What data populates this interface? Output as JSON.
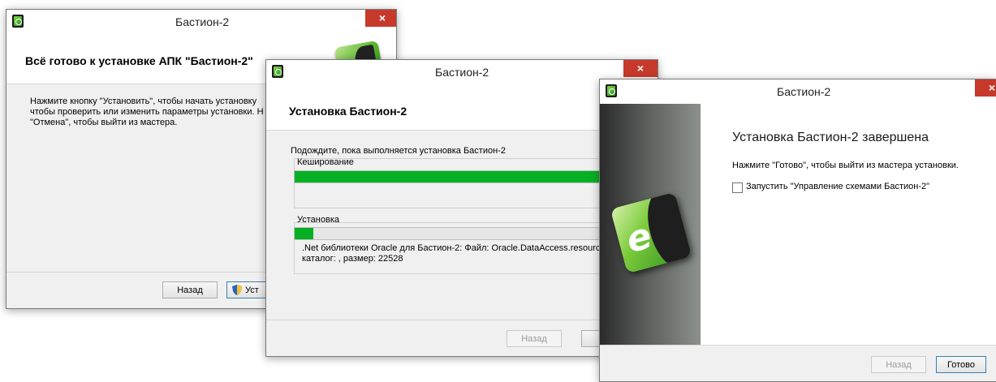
{
  "windows": [
    {
      "title": "Бастион-2",
      "close_glyph": "×",
      "header_title": "Всё готово к установке АПК \"Бастион-2\"",
      "body_lines": [
        "Нажмите кнопку \"Установить\", чтобы начать установку",
        "чтобы проверить или изменить параметры установки. Н",
        "\"Отмена\", чтобы выйти из мастера."
      ],
      "back_label": "Назад",
      "install_label": "Установить",
      "install_visible_text": "Уст"
    },
    {
      "title": "Бастион-2",
      "close_glyph": "×",
      "header_title": "Установка Бастион-2",
      "status_text": "Подождите, пока выполняется установка Бастион-2",
      "caching_label": "Кеширование",
      "caching_progress": 1.0,
      "install_label": "Установка",
      "install_progress": 0.05,
      "detail_line1": ".Net библиотеки Oracle для Бастион-2: Файл: Oracle.DataAccess.resource",
      "detail_line2": "каталог: ,  размер: 22528",
      "back_label": "Назад",
      "cancel_visible_text": "О"
    },
    {
      "title": "Бастион-2",
      "close_glyph": "×",
      "heading": "Установка Бастион-2 завершена",
      "body_text": "Нажмите \"Готово\", чтобы выйти из мастера установки.",
      "checkbox_label": "Запустить \"Управление схемами Бастион-2\"",
      "checkbox_checked": false,
      "back_label": "Назад",
      "finish_label": "Готово"
    }
  ],
  "colors": {
    "progress_green": "#06b025",
    "close_red": "#c7392a",
    "logo_green": "#58b52c"
  },
  "icons": [
    "app-icon",
    "close-icon",
    "shield-icon",
    "bastion-logo"
  ]
}
